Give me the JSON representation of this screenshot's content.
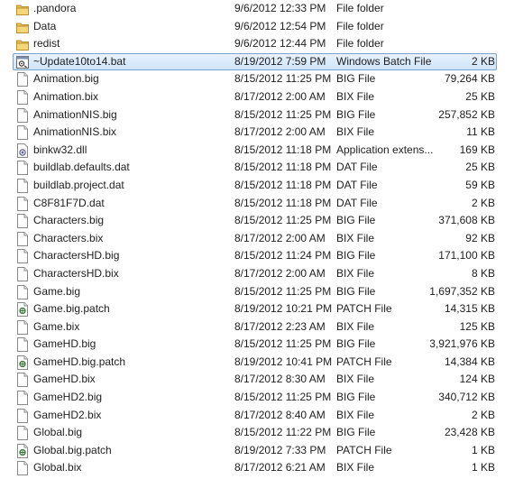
{
  "files": [
    {
      "name": ".pandora",
      "date": "9/6/2012 12:33 PM",
      "type": "File folder",
      "size": "",
      "icon": "folder-icon"
    },
    {
      "name": "Data",
      "date": "9/6/2012 12:54 PM",
      "type": "File folder",
      "size": "",
      "icon": "folder-icon"
    },
    {
      "name": "redist",
      "date": "9/6/2012 12:44 PM",
      "type": "File folder",
      "size": "",
      "icon": "folder-icon"
    },
    {
      "name": "~Update10to14.bat",
      "date": "8/19/2012 7:59 PM",
      "type": "Windows Batch File",
      "size": "2 KB",
      "icon": "batch-file-icon",
      "selected": true
    },
    {
      "name": "Animation.big",
      "date": "8/15/2012 11:25 PM",
      "type": "BIG File",
      "size": "79,264 KB",
      "icon": "file-icon"
    },
    {
      "name": "Animation.bix",
      "date": "8/17/2012 2:00 AM",
      "type": "BIX File",
      "size": "25 KB",
      "icon": "file-icon"
    },
    {
      "name": "AnimationNIS.big",
      "date": "8/15/2012 11:25 PM",
      "type": "BIG File",
      "size": "257,852 KB",
      "icon": "file-icon"
    },
    {
      "name": "AnimationNIS.bix",
      "date": "8/17/2012 2:00 AM",
      "type": "BIX File",
      "size": "11 KB",
      "icon": "file-icon"
    },
    {
      "name": "binkw32.dll",
      "date": "8/15/2012 11:18 PM",
      "type": "Application extens...",
      "size": "169 KB",
      "icon": "dll-file-icon"
    },
    {
      "name": "buildlab.defaults.dat",
      "date": "8/15/2012 11:18 PM",
      "type": "DAT File",
      "size": "25 KB",
      "icon": "file-icon"
    },
    {
      "name": "buildlab.project.dat",
      "date": "8/15/2012 11:18 PM",
      "type": "DAT File",
      "size": "59 KB",
      "icon": "file-icon"
    },
    {
      "name": "C8F81F7D.dat",
      "date": "8/15/2012 11:18 PM",
      "type": "DAT File",
      "size": "2 KB",
      "icon": "file-icon"
    },
    {
      "name": "Characters.big",
      "date": "8/15/2012 11:25 PM",
      "type": "BIG File",
      "size": "371,608 KB",
      "icon": "file-icon"
    },
    {
      "name": "Characters.bix",
      "date": "8/17/2012 2:00 AM",
      "type": "BIX File",
      "size": "92 KB",
      "icon": "file-icon"
    },
    {
      "name": "CharactersHD.big",
      "date": "8/15/2012 11:24 PM",
      "type": "BIG File",
      "size": "171,100 KB",
      "icon": "file-icon"
    },
    {
      "name": "CharactersHD.bix",
      "date": "8/17/2012 2:00 AM",
      "type": "BIX File",
      "size": "8 KB",
      "icon": "file-icon"
    },
    {
      "name": "Game.big",
      "date": "8/15/2012 11:25 PM",
      "type": "BIG File",
      "size": "1,697,352 KB",
      "icon": "file-icon"
    },
    {
      "name": "Game.big.patch",
      "date": "8/19/2012 10:21 PM",
      "type": "PATCH File",
      "size": "14,315 KB",
      "icon": "patch-file-icon"
    },
    {
      "name": "Game.bix",
      "date": "8/17/2012 2:23 AM",
      "type": "BIX File",
      "size": "125 KB",
      "icon": "file-icon"
    },
    {
      "name": "GameHD.big",
      "date": "8/15/2012 11:25 PM",
      "type": "BIG File",
      "size": "3,921,976 KB",
      "icon": "file-icon"
    },
    {
      "name": "GameHD.big.patch",
      "date": "8/19/2012 10:41 PM",
      "type": "PATCH File",
      "size": "14,384 KB",
      "icon": "patch-file-icon"
    },
    {
      "name": "GameHD.bix",
      "date": "8/17/2012 8:30 AM",
      "type": "BIX File",
      "size": "124 KB",
      "icon": "file-icon"
    },
    {
      "name": "GameHD2.big",
      "date": "8/15/2012 11:25 PM",
      "type": "BIG File",
      "size": "340,712 KB",
      "icon": "file-icon"
    },
    {
      "name": "GameHD2.bix",
      "date": "8/17/2012 8:40 AM",
      "type": "BIX File",
      "size": "2 KB",
      "icon": "file-icon"
    },
    {
      "name": "Global.big",
      "date": "8/15/2012 11:22 PM",
      "type": "BIG File",
      "size": "23,428 KB",
      "icon": "file-icon"
    },
    {
      "name": "Global.big.patch",
      "date": "8/19/2012 7:33 PM",
      "type": "PATCH File",
      "size": "1 KB",
      "icon": "patch-file-icon"
    },
    {
      "name": "Global.bix",
      "date": "8/17/2012 6:21 AM",
      "type": "BIX File",
      "size": "1 KB",
      "icon": "file-icon"
    }
  ]
}
